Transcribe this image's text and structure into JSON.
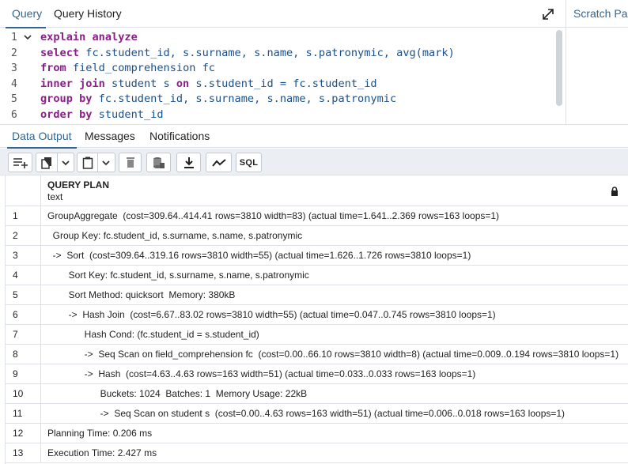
{
  "top_tabs": [
    {
      "label": "Query"
    },
    {
      "label": "Query History"
    }
  ],
  "scratch_pad": {
    "label": "Scratch Pad"
  },
  "editor": {
    "line_numbers": [
      "1",
      "2",
      "3",
      "4",
      "5",
      "6"
    ],
    "lines": [
      [
        {
          "t": "explain analyze",
          "k": true
        }
      ],
      [
        {
          "t": "select",
          "k": true
        },
        {
          "t": " fc.student_id, s.surname, s.name, s.patronymic, avg(mark)",
          "k": false
        }
      ],
      [
        {
          "t": "from",
          "k": true
        },
        {
          "t": " field_comprehension fc",
          "k": false
        }
      ],
      [
        {
          "t": "inner join",
          "k": true
        },
        {
          "t": " student s ",
          "k": false
        },
        {
          "t": "on",
          "k": true
        },
        {
          "t": " s.student_id = fc.student_id",
          "k": false
        }
      ],
      [
        {
          "t": "group by",
          "k": true
        },
        {
          "t": " fc.student_id, s.surname, s.name, s.patronymic",
          "k": false
        }
      ],
      [
        {
          "t": "order by",
          "k": true
        },
        {
          "t": " student_id",
          "k": false
        }
      ]
    ]
  },
  "result_tabs": [
    {
      "label": "Data Output"
    },
    {
      "label": "Messages"
    },
    {
      "label": "Notifications"
    }
  ],
  "toolbar": {
    "sql_label": "SQL"
  },
  "grid": {
    "column": {
      "name": "QUERY PLAN",
      "type": "text"
    },
    "rows": [
      {
        "n": "1",
        "text": "GroupAggregate  (cost=309.64..414.41 rows=3810 width=83) (actual time=1.641..2.369 rows=163 loops=1)"
      },
      {
        "n": "2",
        "text": "  Group Key: fc.student_id, s.surname, s.name, s.patronymic"
      },
      {
        "n": "3",
        "text": "  ->  Sort  (cost=309.64..319.16 rows=3810 width=55) (actual time=1.626..1.726 rows=3810 loops=1)"
      },
      {
        "n": "4",
        "text": "        Sort Key: fc.student_id, s.surname, s.name, s.patronymic"
      },
      {
        "n": "5",
        "text": "        Sort Method: quicksort  Memory: 380kB"
      },
      {
        "n": "6",
        "text": "        ->  Hash Join  (cost=6.67..83.02 rows=3810 width=55) (actual time=0.047..0.745 rows=3810 loops=1)"
      },
      {
        "n": "7",
        "text": "              Hash Cond: (fc.student_id = s.student_id)"
      },
      {
        "n": "8",
        "text": "              ->  Seq Scan on field_comprehension fc  (cost=0.00..66.10 rows=3810 width=8) (actual time=0.009..0.194 rows=3810 loops=1)"
      },
      {
        "n": "9",
        "text": "              ->  Hash  (cost=4.63..4.63 rows=163 width=51) (actual time=0.033..0.033 rows=163 loops=1)"
      },
      {
        "n": "10",
        "text": "                    Buckets: 1024  Batches: 1  Memory Usage: 22kB"
      },
      {
        "n": "11",
        "text": "                    ->  Seq Scan on student s  (cost=0.00..4.63 rows=163 width=51) (actual time=0.006..0.018 rows=163 loops=1)"
      },
      {
        "n": "12",
        "text": "Planning Time: 0.206 ms"
      },
      {
        "n": "13",
        "text": "Execution Time: 2.427 ms"
      }
    ]
  },
  "colors": {
    "accent": "#326690",
    "keyword": "#8a1f8a",
    "identifier": "#1b4f8a",
    "border": "#dde0e6",
    "toolbar_bg": "#ebeef3"
  },
  "icons": [
    "expand-icon",
    "fold-chevron-icon",
    "add-row-icon",
    "copy-icon",
    "chevron-down-icon",
    "paste-icon",
    "delete-icon",
    "save-data-icon",
    "download-icon",
    "graph-icon",
    "lock-icon"
  ]
}
